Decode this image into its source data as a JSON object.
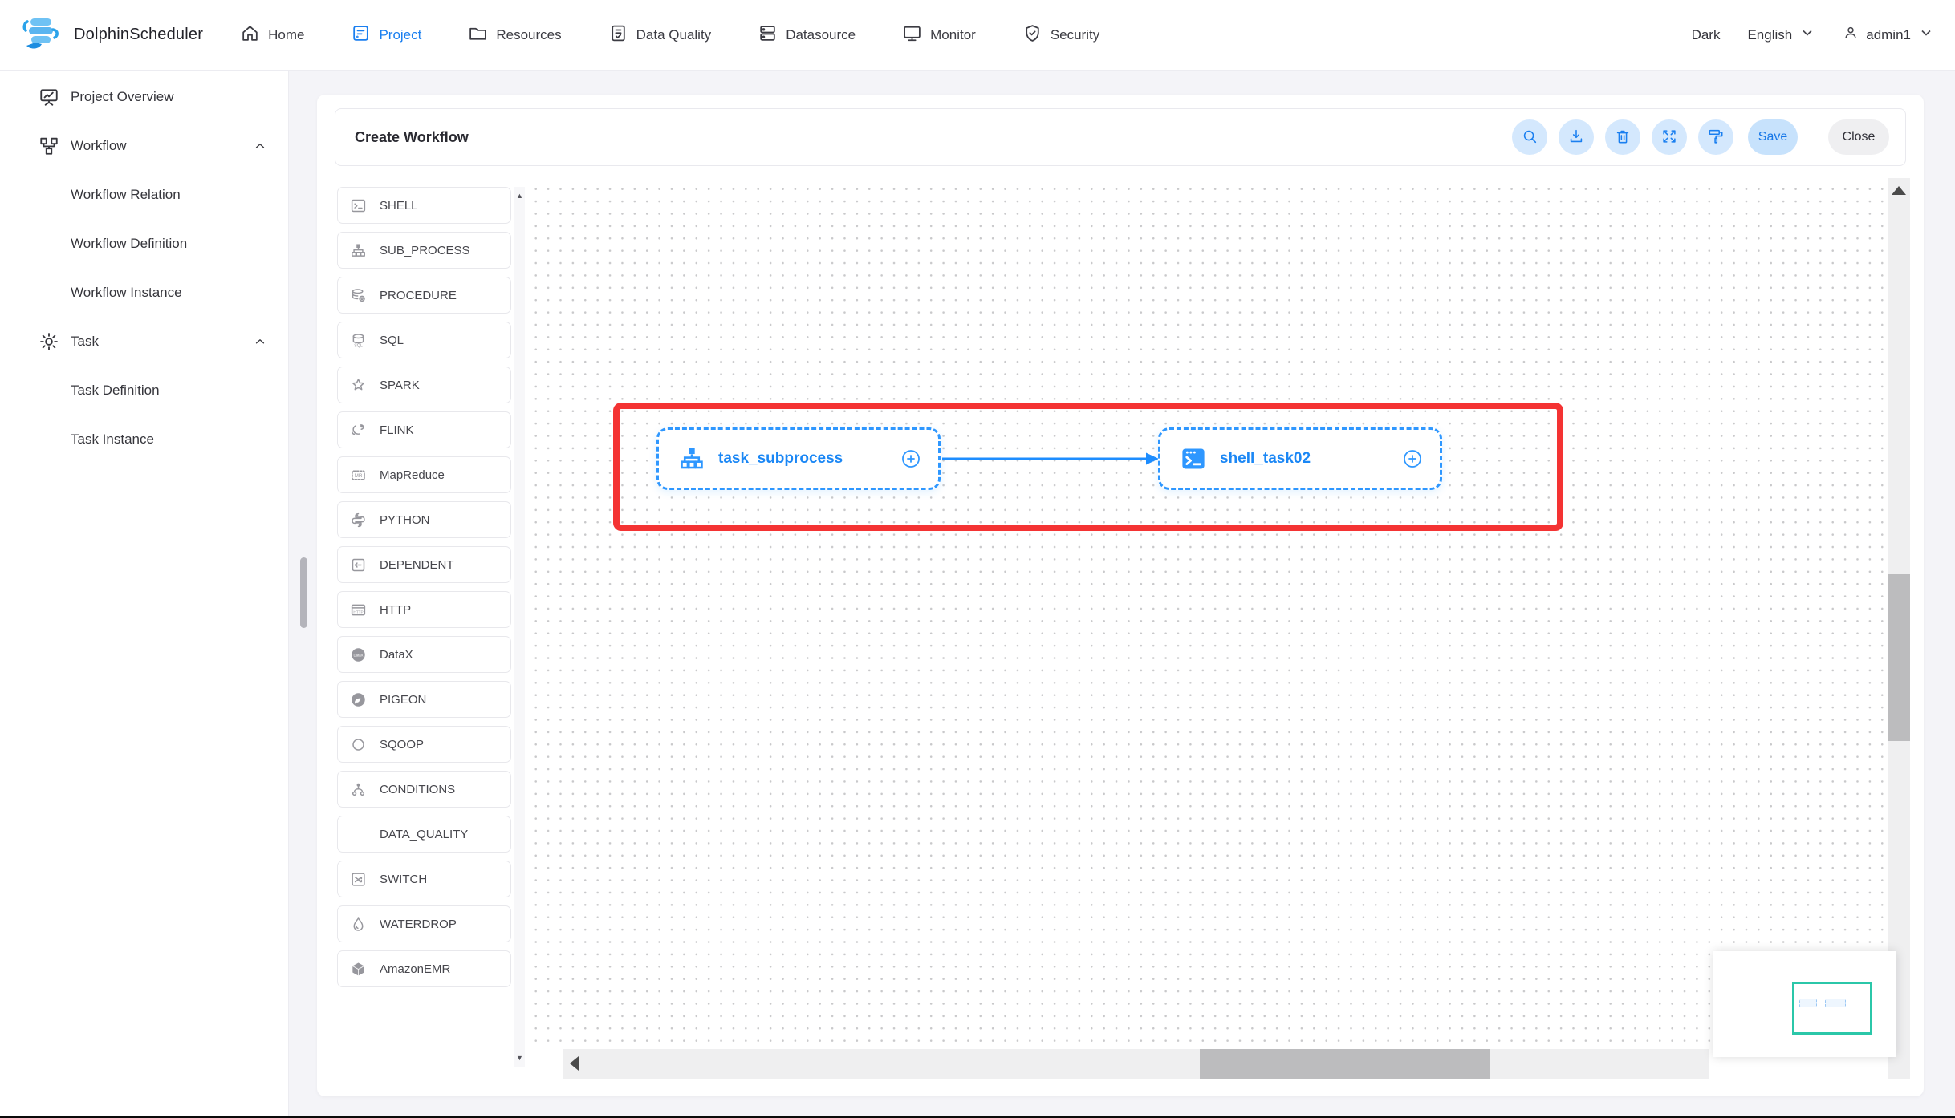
{
  "navbar": {
    "brand": "DolphinScheduler",
    "items": [
      {
        "label": "Home",
        "icon": "home-icon",
        "active": false
      },
      {
        "label": "Project",
        "icon": "project-icon",
        "active": true
      },
      {
        "label": "Resources",
        "icon": "resources-icon",
        "active": false
      },
      {
        "label": "Data Quality",
        "icon": "data-quality-icon",
        "active": false
      },
      {
        "label": "Datasource",
        "icon": "datasource-icon",
        "active": false
      },
      {
        "label": "Monitor",
        "icon": "monitor-icon",
        "active": false
      },
      {
        "label": "Security",
        "icon": "security-icon",
        "active": false
      }
    ],
    "right": {
      "theme_label": "Dark",
      "language": "English",
      "username": "admin1"
    }
  },
  "sidebar": {
    "items": [
      {
        "label": "Project Overview",
        "icon": "project-overview-icon",
        "type": "parent",
        "expandable": false
      },
      {
        "label": "Workflow",
        "icon": "workflow-icon",
        "type": "parent",
        "expandable": true,
        "expanded": true
      },
      {
        "label": "Workflow Relation",
        "type": "sub"
      },
      {
        "label": "Workflow Definition",
        "type": "sub"
      },
      {
        "label": "Workflow Instance",
        "type": "sub"
      },
      {
        "label": "Task",
        "icon": "gear-icon",
        "type": "parent",
        "expandable": true,
        "expanded": true
      },
      {
        "label": "Task Definition",
        "type": "sub"
      },
      {
        "label": "Task Instance",
        "type": "sub"
      }
    ]
  },
  "header": {
    "title": "Create Workflow",
    "toolbar_buttons": [
      {
        "name": "search",
        "icon": "search-icon"
      },
      {
        "name": "download",
        "icon": "download-icon"
      },
      {
        "name": "delete",
        "icon": "trash-icon"
      },
      {
        "name": "fullscreen",
        "icon": "fullscreen-icon"
      },
      {
        "name": "format",
        "icon": "format-icon"
      }
    ],
    "save_label": "Save",
    "close_label": "Close"
  },
  "task_panel": {
    "items": [
      {
        "label": "SHELL",
        "icon": "shell-icon"
      },
      {
        "label": "SUB_PROCESS",
        "icon": "subprocess-icon"
      },
      {
        "label": "PROCEDURE",
        "icon": "procedure-icon"
      },
      {
        "label": "SQL",
        "icon": "sql-icon"
      },
      {
        "label": "SPARK",
        "icon": "spark-icon"
      },
      {
        "label": "FLINK",
        "icon": "flink-icon"
      },
      {
        "label": "MapReduce",
        "icon": "mapreduce-icon"
      },
      {
        "label": "PYTHON",
        "icon": "python-icon"
      },
      {
        "label": "DEPENDENT",
        "icon": "dependent-icon"
      },
      {
        "label": "HTTP",
        "icon": "http-icon"
      },
      {
        "label": "DataX",
        "icon": "datax-icon"
      },
      {
        "label": "PIGEON",
        "icon": "pigeon-icon"
      },
      {
        "label": "SQOOP",
        "icon": "sqoop-icon"
      },
      {
        "label": "CONDITIONS",
        "icon": "conditions-icon"
      },
      {
        "label": "DATA_QUALITY",
        "icon": "none"
      },
      {
        "label": "SWITCH",
        "icon": "switch-icon"
      },
      {
        "label": "WATERDROP",
        "icon": "waterdrop-icon"
      },
      {
        "label": "AmazonEMR",
        "icon": "amazon-emr-icon"
      }
    ]
  },
  "canvas": {
    "nodes": [
      {
        "label": "task_subprocess",
        "icon": "subprocess-node-icon"
      },
      {
        "label": "shell_task02",
        "icon": "shell-node-icon"
      }
    ],
    "connection": {
      "from": "task_subprocess",
      "to": "shell_task02"
    },
    "annotation": "red-rectangle-highlight"
  },
  "colors": {
    "primary_blue": "#1a7ff0",
    "node_blue": "#2e97ff",
    "annotation_red": "#f43333",
    "minimap_viewport_teal": "#2bc7a9",
    "canvas_dot": "#c9c9cb"
  }
}
